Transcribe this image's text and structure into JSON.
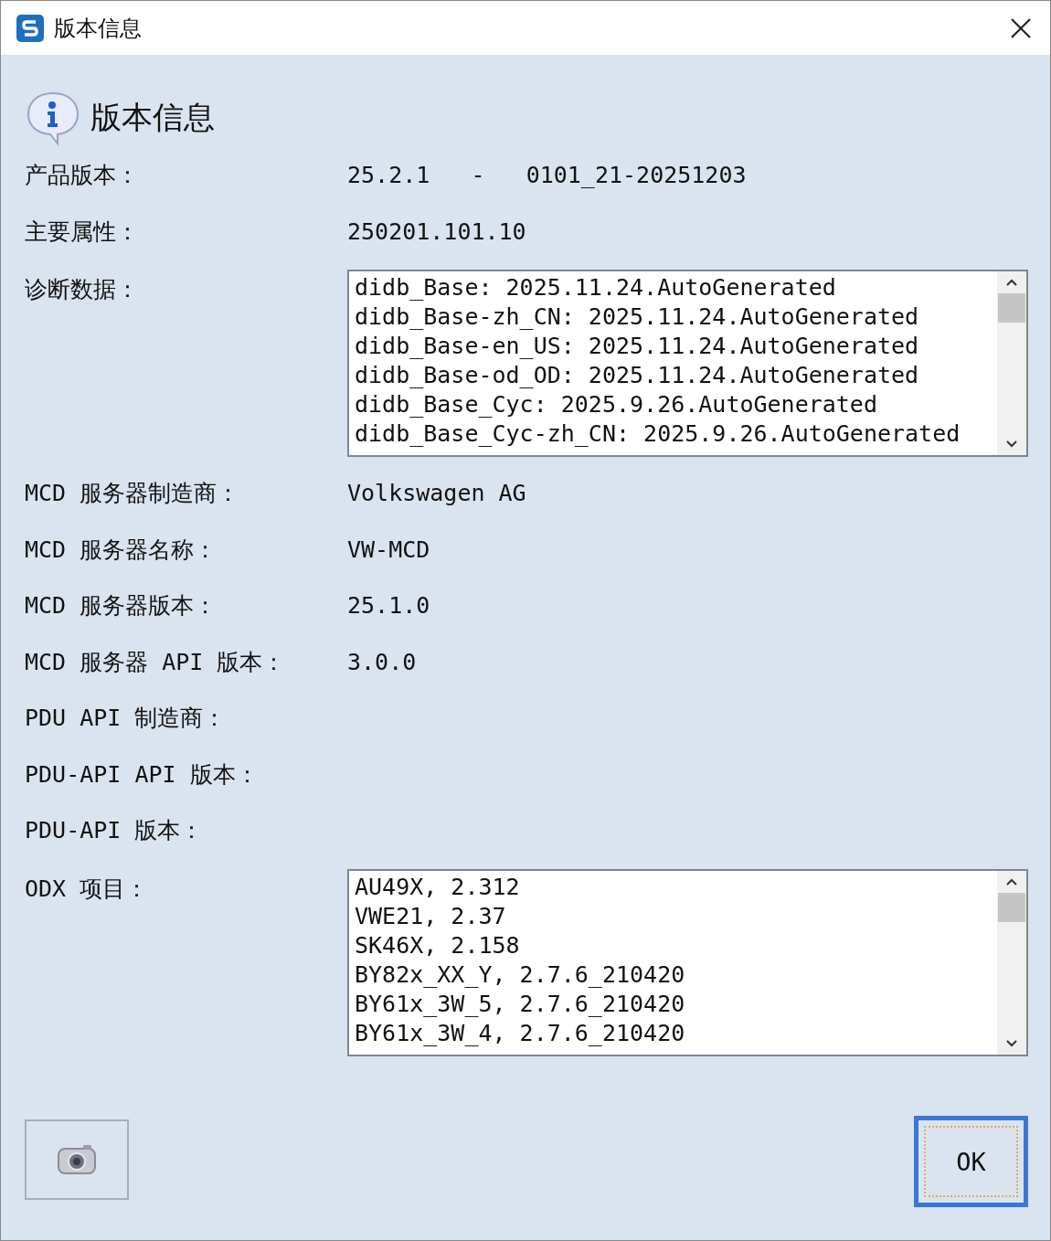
{
  "window": {
    "title": "版本信息"
  },
  "header": {
    "title": "版本信息"
  },
  "fields": [
    {
      "kind": "text",
      "label": "产品版本：",
      "value": "25.2.1   -   0101_21-20251203"
    },
    {
      "kind": "text",
      "label": "主要属性：",
      "value": "250201.101.10"
    },
    {
      "kind": "list",
      "label": "诊断数据：",
      "lines": [
        "didb_Base: 2025.11.24.AutoGenerated",
        "didb_Base-zh_CN: 2025.11.24.AutoGenerated",
        "didb_Base-en_US: 2025.11.24.AutoGenerated",
        "didb_Base-od_OD: 2025.11.24.AutoGenerated",
        "didb_Base_Cyc: 2025.9.26.AutoGenerated",
        "didb_Base_Cyc-zh_CN: 2025.9.26.AutoGenerated"
      ]
    },
    {
      "kind": "text",
      "label": "MCD 服务器制造商：",
      "value": "Volkswagen AG"
    },
    {
      "kind": "text",
      "label": "MCD 服务器名称：",
      "value": "VW-MCD"
    },
    {
      "kind": "text",
      "label": "MCD 服务器版本：",
      "value": "25.1.0"
    },
    {
      "kind": "text",
      "label": "MCD 服务器 API 版本：",
      "value": "3.0.0"
    },
    {
      "kind": "text",
      "label": "PDU API 制造商："
    },
    {
      "kind": "text",
      "label": "PDU-API API 版本："
    },
    {
      "kind": "text",
      "label": "PDU-API 版本："
    },
    {
      "kind": "list",
      "label": "ODX 项目：",
      "lines": [
        "AU49X, 2.312",
        "VWE21, 2.37",
        "SK46X, 2.158",
        "BY82x_XX_Y, 2.7.6_210420",
        "BY61x_3W_5, 2.7.6_210420",
        "BY61x_3W_4, 2.7.6_210420"
      ]
    }
  ],
  "buttons": {
    "ok": "OK"
  }
}
